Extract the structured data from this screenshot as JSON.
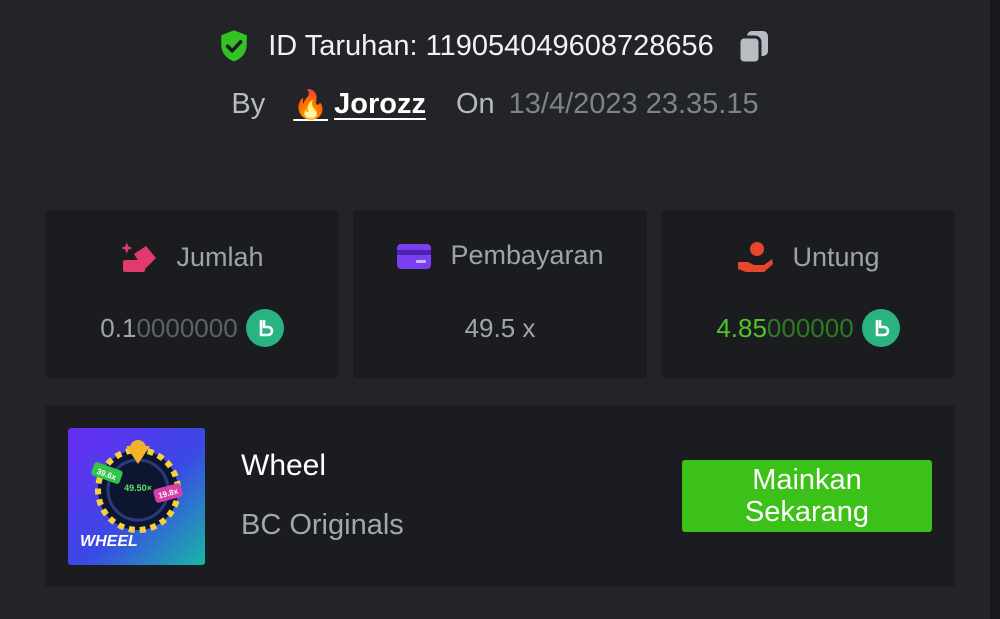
{
  "header": {
    "bet_id_label": "ID Taruhan:",
    "bet_id": "119054049608728656",
    "by_label": "By",
    "username": "Jorozz",
    "on_label": "On",
    "datetime": "13/4/2023 23.35.15"
  },
  "stats": {
    "amount": {
      "label": "Jumlah",
      "value_bright": "0.1",
      "value_dim": "0000000",
      "currency_icon": "bc-coin-icon"
    },
    "payout": {
      "label": "Pembayaran",
      "value": "49.5 x"
    },
    "profit": {
      "label": "Untung",
      "value_bright": "4.85",
      "value_dim": "000000",
      "currency_icon": "bc-coin-icon"
    }
  },
  "game": {
    "title": "Wheel",
    "provider": "BC Originals",
    "play_label": "Mainkan Sekarang",
    "thumbnail": {
      "wordmark": "WHEEL",
      "multiplier_center": "49.50×",
      "multiplier_left": "39.6x",
      "multiplier_right": "19.8x"
    }
  },
  "colors": {
    "background": "#232427",
    "card": "#1b1c1f",
    "accent_green": "#3bc117",
    "profit_green": "#4ec529",
    "coin": "#29b381"
  }
}
